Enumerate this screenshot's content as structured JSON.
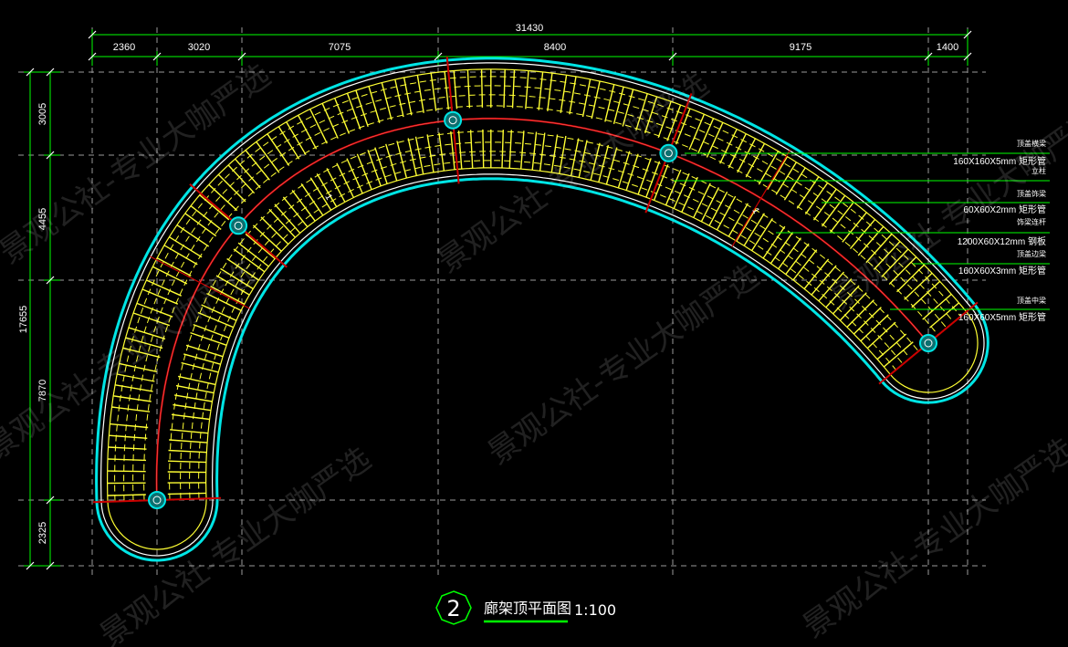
{
  "title": {
    "number": "2",
    "text": "廊架顶平面图",
    "scale": "1:100"
  },
  "dimensions": {
    "top_total": "31430",
    "top_segments": [
      "2360",
      "3020",
      "7075",
      "8400",
      "9175",
      "1400"
    ],
    "left_total": "17655",
    "left_segments": [
      "3005",
      "4455",
      "7870",
      "2325"
    ]
  },
  "annotations": [
    {
      "small": "顶盖横梁",
      "main": "160X160X5mm 矩形管"
    },
    {
      "small": "立柱",
      "main": ""
    },
    {
      "small": "顶盖饰梁",
      "main": "60X60X2mm 矩形管"
    },
    {
      "small": "饰梁连杆",
      "main": "1200X60X12mm 钢板"
    },
    {
      "small": "顶盖边梁",
      "main": "160X60X3mm 矩形管"
    },
    {
      "small": "顶盖中梁",
      "main": "160X60X5mm 矩形管"
    }
  ],
  "section_labels": [
    "1",
    "1"
  ],
  "watermark": "景观公社-专业大咖严选",
  "colors": {
    "background": "#000000",
    "outline": "#00e5e5",
    "slats": "#ffff33",
    "beam": "#cc0000",
    "dimension": "#00ff00",
    "grid": "#9a9a9a"
  }
}
